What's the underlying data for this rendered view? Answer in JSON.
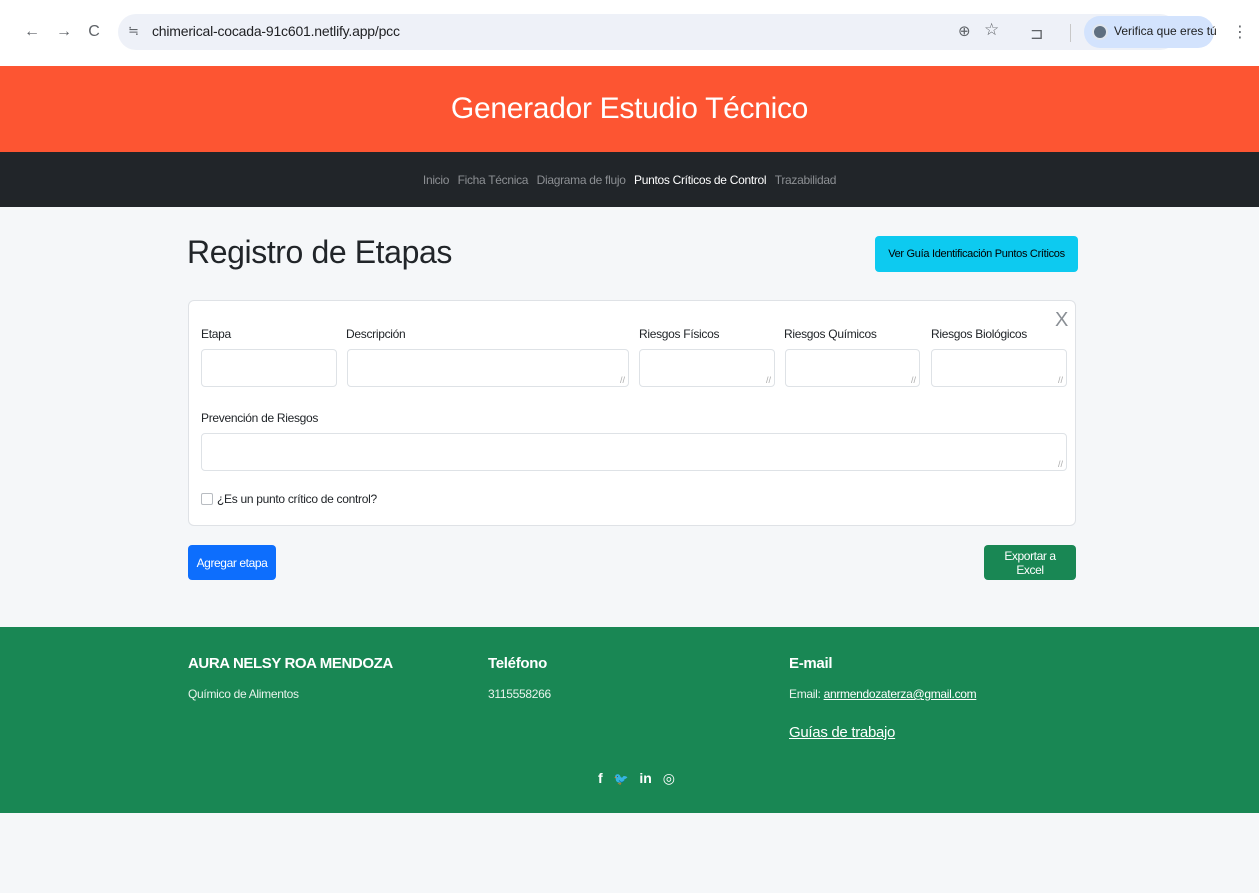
{
  "browser": {
    "back": "←",
    "forward": "→",
    "reload": "C",
    "site_icon": "≒",
    "url": "chimerical-cocada-91c601.netlify.app/pcc",
    "zoom_icon": "⊕",
    "star_icon": "☆",
    "extensions_icon": "⊐",
    "profile_label": "Verifica que eres tú",
    "menu_icon": "⋮"
  },
  "header": {
    "title": "Generador Estudio Técnico"
  },
  "nav": {
    "items": [
      {
        "label": "Inicio"
      },
      {
        "label": "Ficha Técnica"
      },
      {
        "label": "Diagrama de flujo"
      },
      {
        "label": "Puntos Críticos de Control",
        "active": true
      },
      {
        "label": "Trazabilidad"
      }
    ]
  },
  "main": {
    "heading": "Registro de Etapas",
    "guide_button": "Ver Guía Identificación Puntos Críticos",
    "form": {
      "close": "X",
      "etapa_label": "Etapa",
      "descripcion_label": "Descripción",
      "fisicos_label": "Riesgos Físicos",
      "quimicos_label": "Riesgos Químicos",
      "biologicos_label": "Riesgos Biológicos",
      "prevencion_label": "Prevención de Riesgos",
      "critical_label": "¿Es un punto crítico de control?",
      "critical_checked": false
    },
    "add_button": "Agregar etapa",
    "export_button": "Exportar a Excel"
  },
  "footer": {
    "name": "AURA NELSY ROA MENDOZA",
    "role": "Químico de Alimentos",
    "phone_heading": "Teléfono",
    "phone": "3115558266",
    "email_heading": "E-mail",
    "email_prefix": "Email:",
    "email": "anrmendozaterza@gmail.com",
    "guides_link": "Guías de trabajo",
    "social": [
      "f",
      "🐦",
      "in",
      "◎"
    ]
  },
  "colors": {
    "header_bg": "#fd5532",
    "nav_bg": "#212529",
    "footer_bg": "#198754",
    "info_button": "#0dcaf0",
    "primary_button": "#0d6efd",
    "success_button": "#198754"
  }
}
